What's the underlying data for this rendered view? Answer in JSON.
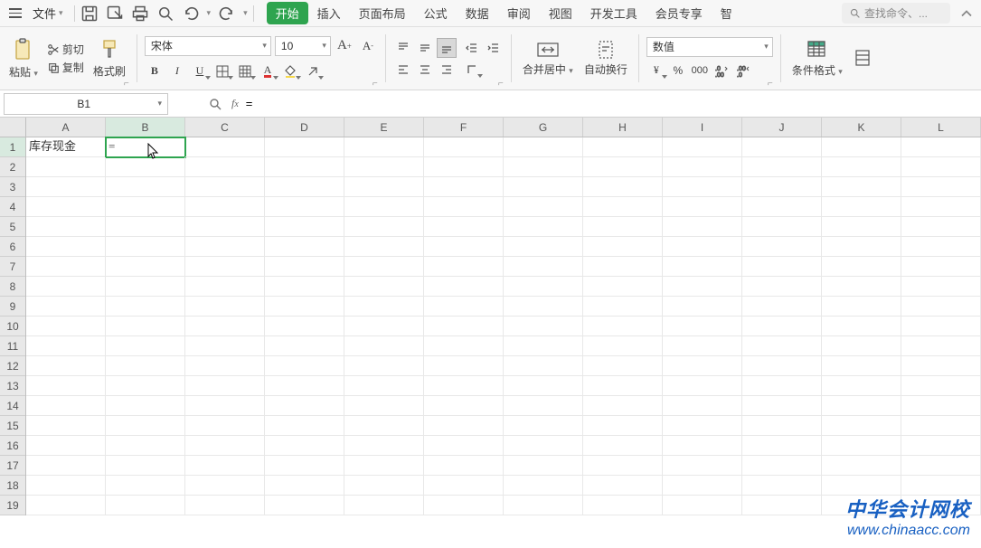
{
  "menu": {
    "file": "文件",
    "tabs": [
      "开始",
      "插入",
      "页面布局",
      "公式",
      "数据",
      "审阅",
      "视图",
      "开发工具",
      "会员专享"
    ],
    "activeTab": 0,
    "extraTab": "智",
    "searchPlaceholder": "查找命令、..."
  },
  "ribbon": {
    "paste": "粘贴",
    "cut": "剪切",
    "copy": "复制",
    "formatPainter": "格式刷",
    "fontName": "宋体",
    "fontSize": "10",
    "mergeCenter": "合并居中",
    "wrapText": "自动换行",
    "numberFormat": "数值",
    "conditionalFormat": "条件格式"
  },
  "namebox": "B1",
  "formulaBar": "=",
  "grid": {
    "columns": [
      "A",
      "B",
      "C",
      "D",
      "E",
      "F",
      "G",
      "H",
      "I",
      "J",
      "K",
      "L"
    ],
    "rows": [
      1,
      2,
      3,
      4,
      5,
      6,
      7,
      8,
      9,
      10,
      11,
      12,
      13,
      14,
      15,
      16,
      17,
      18,
      19
    ],
    "activeCol": "B",
    "activeRow": 1,
    "cellA1": "库存现金",
    "cellB1": "="
  },
  "watermark": {
    "line1": "中华会计网校",
    "line2": "www.chinaacc.com"
  }
}
